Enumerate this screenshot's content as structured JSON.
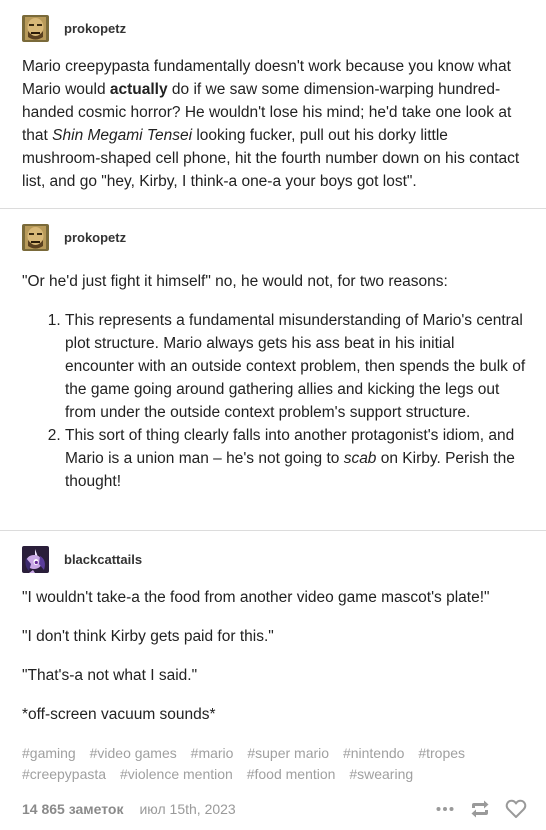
{
  "posts": [
    {
      "username": "prokopetz",
      "body": {
        "part1": "Mario creepypasta fundamentally doesn't work because you know what Mario would ",
        "bold": "actually",
        "part2": " do if we saw some dimension-warping hundred-handed cosmic horror? He wouldn't lose his mind; he'd take one look at that ",
        "italic": "Shin Megami Tensei",
        "part3": " looking fucker, pull out his dorky little mushroom-shaped cell phone, hit the fourth number down on his contact list, and go \"hey, Kirby, I think-a one-a your boys got lost\"."
      }
    },
    {
      "username": "prokopetz",
      "intro": "\"Or he'd just fight it himself\" no, he would not, for two reasons:",
      "list": [
        {
          "text": "This represents a fundamental misunderstanding of Mario's central plot structure. Mario always gets his ass beat in his initial encounter with an outside context problem, then spends the bulk of the game going around gathering allies and kicking the legs out from under the outside context problem's support structure."
        },
        {
          "text_before": "This sort of thing clearly falls into another protagonist's idiom, and Mario is a union man – he's not going to ",
          "italic": "scab",
          "text_after": " on Kirby. Perish the thought!"
        }
      ]
    },
    {
      "username": "blackcattails",
      "paragraphs": [
        "\"I wouldn't take-a the food from another video game mascot's plate!\"",
        "\"I don't think Kirby gets paid for this.\"",
        "\"That's-a not what I said.\"",
        "*off-screen vacuum sounds*"
      ]
    }
  ],
  "tags": [
    "#gaming",
    "#video games",
    "#mario",
    "#super mario",
    "#nintendo",
    "#tropes",
    "#creepypasta",
    "#violence mention",
    "#food mention",
    "#swearing"
  ],
  "footer": {
    "notes": "14 865 заметок",
    "date": "июл 15th, 2023"
  },
  "icons": {
    "more": "more-icon",
    "reblog": "reblog-icon",
    "like": "heart-icon"
  },
  "colors": {
    "text": "#222222",
    "muted": "#9a9a9a",
    "divider": "#dcdcdc"
  }
}
